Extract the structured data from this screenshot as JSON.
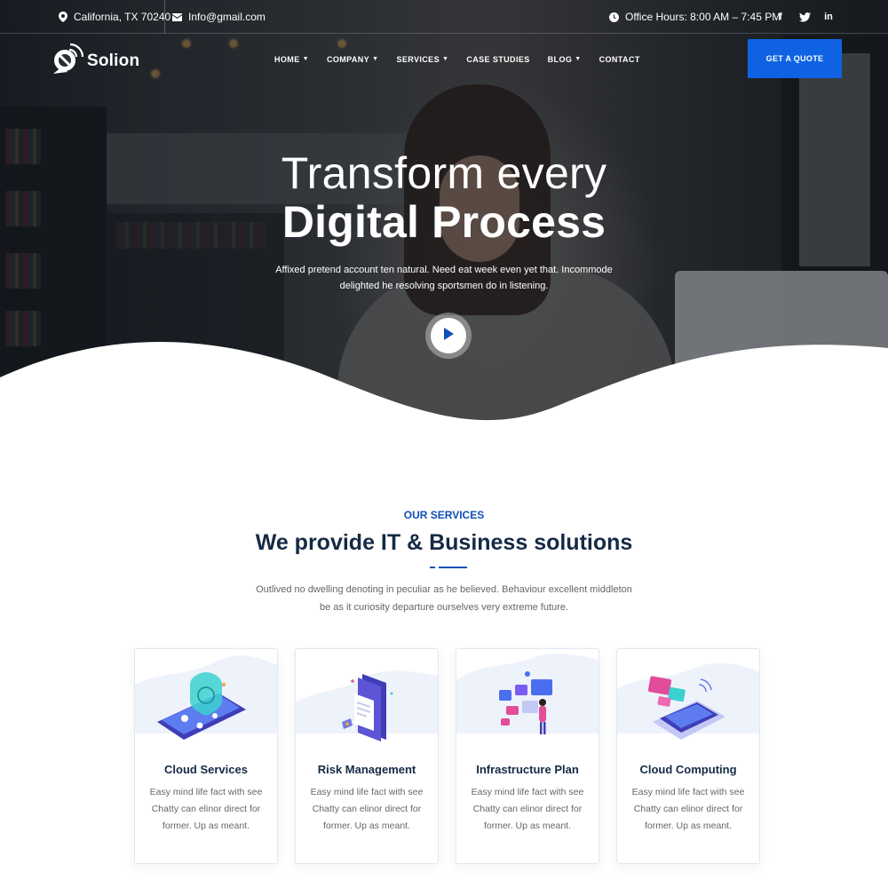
{
  "topbar": {
    "location": "California, TX 70240",
    "email": "Info@gmail.com",
    "office_hours": "Office Hours: 8:00 AM – 7:45 PM",
    "social": [
      "f",
      "t",
      "in"
    ]
  },
  "nav": {
    "brand": "Solion",
    "menu": [
      {
        "label": "HOME",
        "dropdown": true
      },
      {
        "label": "COMPANY",
        "dropdown": true
      },
      {
        "label": "SERVICES",
        "dropdown": true
      },
      {
        "label": "CASE STUDIES",
        "dropdown": false
      },
      {
        "label": "BLOG",
        "dropdown": true
      },
      {
        "label": "CONTACT",
        "dropdown": false
      }
    ],
    "cta": "GET A QUOTE"
  },
  "hero": {
    "title_line1": "Transform every",
    "title_line2": "Digital Process",
    "description": "Affixed pretend account ten natural. Need eat week even yet that. Incommode delighted he resolving sportsmen do in listening."
  },
  "services": {
    "subtitle": "OUR SERVICES",
    "title": "We provide IT & Business solutions",
    "description": "Outlived no dwelling denoting in peculiar as he believed. Behaviour excellent middleton be as it curiosity departure ourselves very extreme future.",
    "cards": [
      {
        "title": "Cloud Services",
        "text": "Easy mind life fact with see Chatty can elinor direct for former. Up as meant."
      },
      {
        "title": "Risk Management",
        "text": "Easy mind life fact with see Chatty can elinor direct for former. Up as meant."
      },
      {
        "title": "Infrastructure Plan",
        "text": "Easy mind life fact with see Chatty can elinor direct for former. Up as meant."
      },
      {
        "title": "Cloud Computing",
        "text": "Easy mind life fact with see Chatty can elinor direct for former. Up as meant."
      }
    ]
  },
  "colors": {
    "accent": "#0f63e3",
    "heading": "#152a45",
    "subtitle": "#0f4fb8"
  }
}
